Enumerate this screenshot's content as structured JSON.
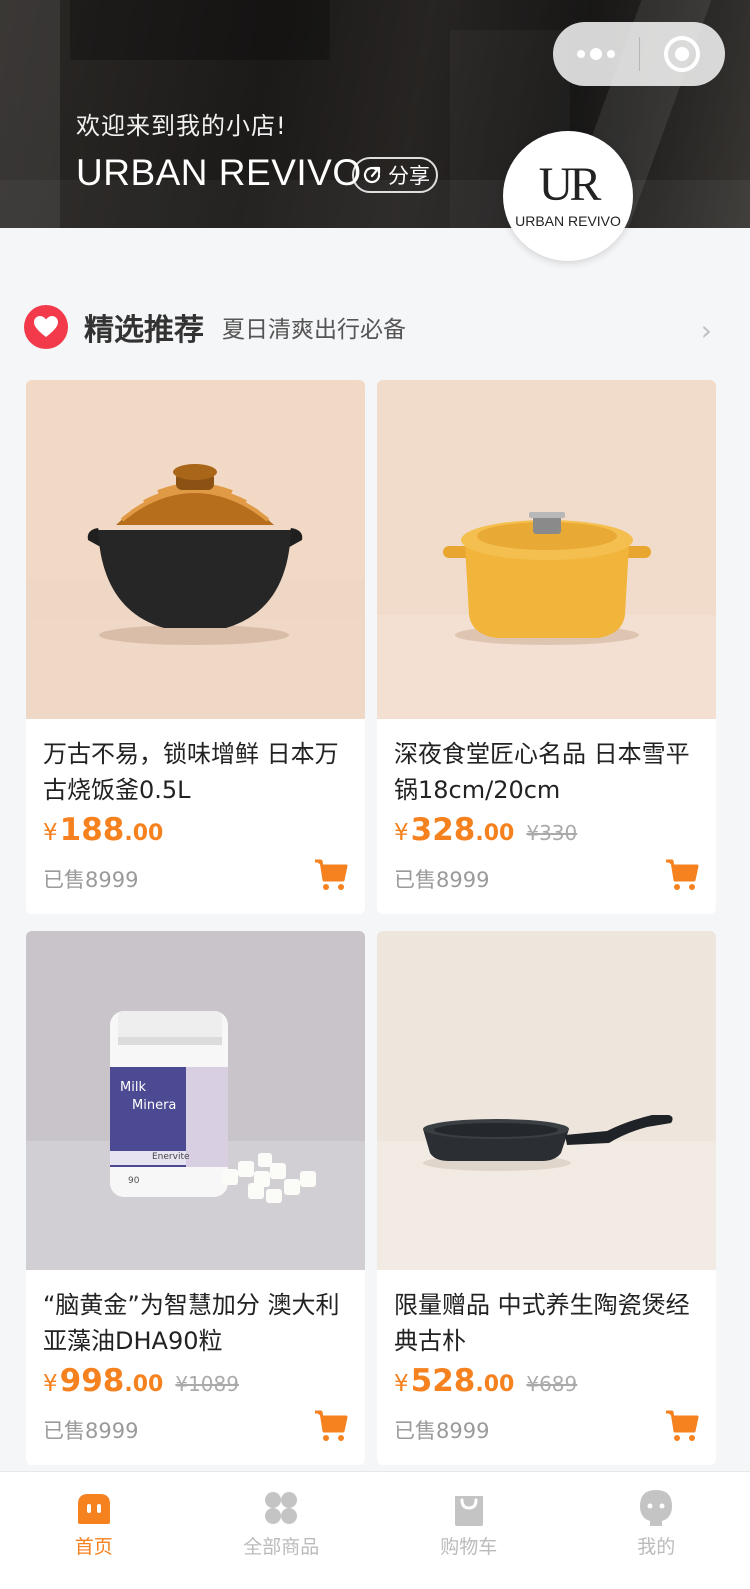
{
  "header": {
    "welcome": "欢迎来到我的小店!",
    "brand": "URBAN REVIVO",
    "share_label": "分享",
    "logo_mark": "UR",
    "logo_text": "URBAN REVIVO"
  },
  "section": {
    "title": "精选推荐",
    "subtitle": "夏日清爽出行必备",
    "arrow": "›"
  },
  "products": [
    {
      "name": "万古不易，锁味增鲜 日本万古烧饭釜0.5L",
      "yen": "¥",
      "price_int": "188",
      "price_dec": ".00",
      "original": "",
      "sold": "已售8999"
    },
    {
      "name": "深夜食堂匠心名品 日本雪平锅18cm/20cm",
      "yen": "¥",
      "price_int": "328",
      "price_dec": ".00",
      "original": "¥330",
      "sold": "已售8999"
    },
    {
      "name": "“脑黄金”为智慧加分 澳大利亚藻油DHA90粒",
      "yen": "¥",
      "price_int": "998",
      "price_dec": ".00",
      "original": "¥1089",
      "sold": "已售8999"
    },
    {
      "name": "限量赠品 中式养生陶瓷煲经典古朴",
      "yen": "¥",
      "price_int": "528",
      "price_dec": ".00",
      "original": "¥689",
      "sold": "已售8999"
    }
  ],
  "product_images": {
    "bottle_label_1": "Milk",
    "bottle_label_2": "Minera",
    "bottle_label_3": "Enervite",
    "bottle_count": "90"
  },
  "tabs": [
    {
      "label": "首页",
      "icon": "home-icon",
      "active": true
    },
    {
      "label": "全部商品",
      "icon": "grid-icon",
      "active": false
    },
    {
      "label": "购物车",
      "icon": "bag-icon",
      "active": false
    },
    {
      "label": "我的",
      "icon": "user-icon",
      "active": false
    }
  ],
  "colors": {
    "accent": "#f5811f",
    "heart": "#f23a4a",
    "tab_inactive": "#bbbbbb"
  }
}
